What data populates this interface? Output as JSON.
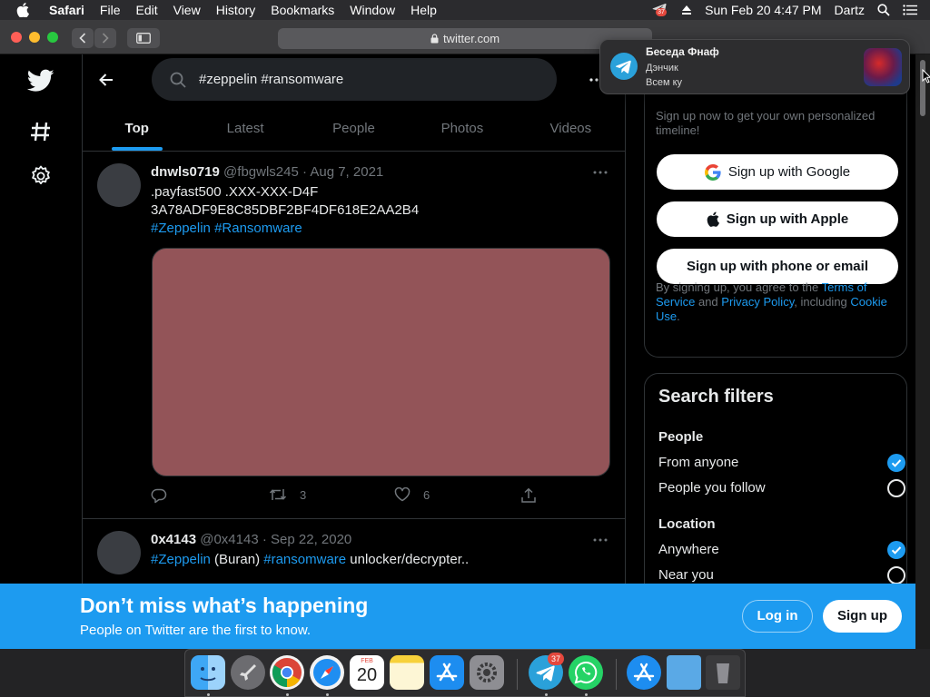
{
  "menubar": {
    "app": "Safari",
    "items": [
      "File",
      "Edit",
      "View",
      "History",
      "Bookmarks",
      "Window",
      "Help"
    ],
    "telegram_badge": "37",
    "datetime": "Sun Feb 20  4:47 PM",
    "user": "Dartz"
  },
  "browser": {
    "url": "twitter.com"
  },
  "search": {
    "query": "#zeppelin #ransomware",
    "tabs": [
      "Top",
      "Latest",
      "People",
      "Photos",
      "Videos"
    ],
    "active_tab": "Top"
  },
  "tweets": [
    {
      "name": "dnwls0719",
      "handle": "@fbgwls245",
      "date": "Aug 7, 2021",
      "line1": ".payfast500 .XXX-XXX-D4F",
      "line2": "3A78ADF9E8C85DBF2BF4DF618E2AA2B4",
      "tag1": "#Zeppelin",
      "tag2": "#Ransomware",
      "media_color": "#935458",
      "retweets": "3",
      "likes": "6"
    },
    {
      "name": "0x4143",
      "handle": "@0x4143",
      "date": "Sep 22, 2020",
      "tag1": "#Zeppelin",
      "mid": " (Buran) ",
      "tag2": "#ransomware",
      "rest": " unlocker/decrypter.."
    }
  ],
  "signup": {
    "prompt": "Sign up now to get your own personalized timeline!",
    "google": "Sign up with Google",
    "apple": "Sign up with Apple",
    "phone": "Sign up with phone or email",
    "legal_1": "By signing up, you agree to the ",
    "terms": "Terms of Service",
    "legal_2": " and ",
    "privacy": "Privacy Policy",
    "legal_3": ", including ",
    "cookie": "Cookie Use",
    "legal_4": "."
  },
  "filters": {
    "title": "Search filters",
    "people_label": "People",
    "from_anyone": "From anyone",
    "people_you_follow": "People you follow",
    "location_label": "Location",
    "anywhere": "Anywhere",
    "near_you": "Near you",
    "selected": [
      "From anyone",
      "Anywhere"
    ]
  },
  "banner": {
    "title": "Don’t miss what’s happening",
    "subtitle": "People on Twitter are the first to know.",
    "login": "Log in",
    "signup": "Sign up"
  },
  "notification": {
    "title": "Беседа Фнаф",
    "sender": "Дэнчик",
    "message": "Всем ку"
  },
  "dock": {
    "telegram_badge": "37",
    "calendar_month": "FEB",
    "calendar_day": "20"
  },
  "colors": {
    "accent": "#1d9bf0",
    "background": "#000000",
    "border": "#2f3336"
  }
}
